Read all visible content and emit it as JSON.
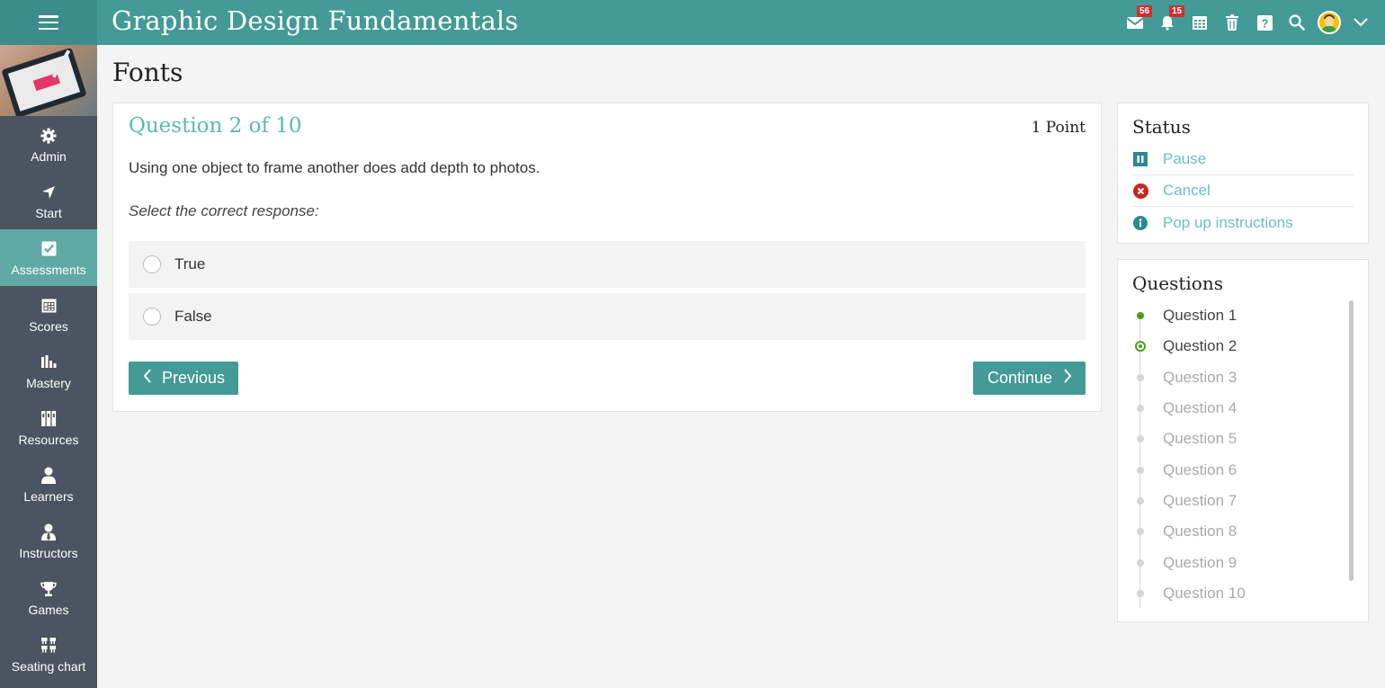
{
  "header": {
    "title": "Graphic Design Fundamentals",
    "messages_badge": "56",
    "notifications_badge": "15"
  },
  "sidebar": {
    "items": [
      {
        "label": "Admin",
        "icon": "gear-icon"
      },
      {
        "label": "Start",
        "icon": "navigation-arrow-icon"
      },
      {
        "label": "Assessments",
        "icon": "checkbox-icon"
      },
      {
        "label": "Scores",
        "icon": "gradebook-icon"
      },
      {
        "label": "Mastery",
        "icon": "bar-chart-icon"
      },
      {
        "label": "Resources",
        "icon": "books-icon"
      },
      {
        "label": "Learners",
        "icon": "person-icon"
      },
      {
        "label": "Instructors",
        "icon": "instructor-icon"
      },
      {
        "label": "Games",
        "icon": "trophy-icon"
      },
      {
        "label": "Seating chart",
        "icon": "seating-icon"
      }
    ],
    "active_item": "Assessments"
  },
  "page": {
    "title": "Fonts"
  },
  "question": {
    "heading": "Question 2 of 10",
    "points": "1 Point",
    "text": "Using one object to frame another does add depth to photos.",
    "instruction": "Select the correct response:",
    "options": [
      "True",
      "False"
    ],
    "previous_label": "Previous",
    "continue_label": "Continue"
  },
  "status_panel": {
    "title": "Status",
    "actions": [
      {
        "label": "Pause",
        "icon": "pause-icon"
      },
      {
        "label": "Cancel",
        "icon": "cancel-icon"
      },
      {
        "label": "Pop up instructions",
        "icon": "info-icon"
      }
    ]
  },
  "questions_panel": {
    "title": "Questions",
    "items": [
      "Question 1",
      "Question 2",
      "Question 3",
      "Question 4",
      "Question 5",
      "Question 6",
      "Question 7",
      "Question 8",
      "Question 9",
      "Question 10"
    ],
    "current_index": 2,
    "visited": [
      1,
      2
    ]
  },
  "colors": {
    "topbar": "#439a97",
    "sidebar": "#4b5460",
    "accent": "#5bb8b4",
    "progress_done": "#4f9b1e",
    "badge": "#d12f2f"
  }
}
